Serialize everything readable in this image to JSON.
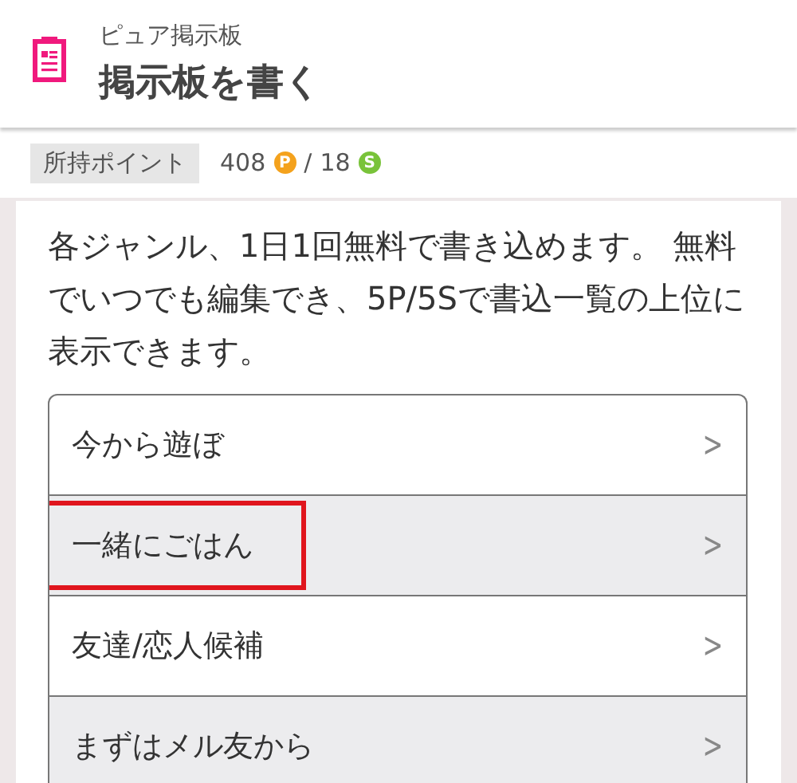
{
  "header": {
    "subtitle": "ピュア掲示板",
    "title": "掲示板を書く"
  },
  "points": {
    "label": "所持ポイント",
    "p_value": "408",
    "p_badge": "P",
    "separator": "/",
    "s_value": "18",
    "s_badge": "S"
  },
  "intro": "各ジャンル、1日1回無料で書き込めます。 無料でいつでも編集でき、5P/5Sで書込一覧の上位に表示できます。",
  "genres": [
    {
      "label": "今から遊ぼ",
      "chevron": ">",
      "highlighted": false
    },
    {
      "label": "一緒にごはん",
      "chevron": ">",
      "highlighted": true
    },
    {
      "label": "友達/恋人候補",
      "chevron": ">",
      "highlighted": false
    },
    {
      "label": "まずはメル友から",
      "chevron": ">",
      "highlighted": false
    }
  ]
}
